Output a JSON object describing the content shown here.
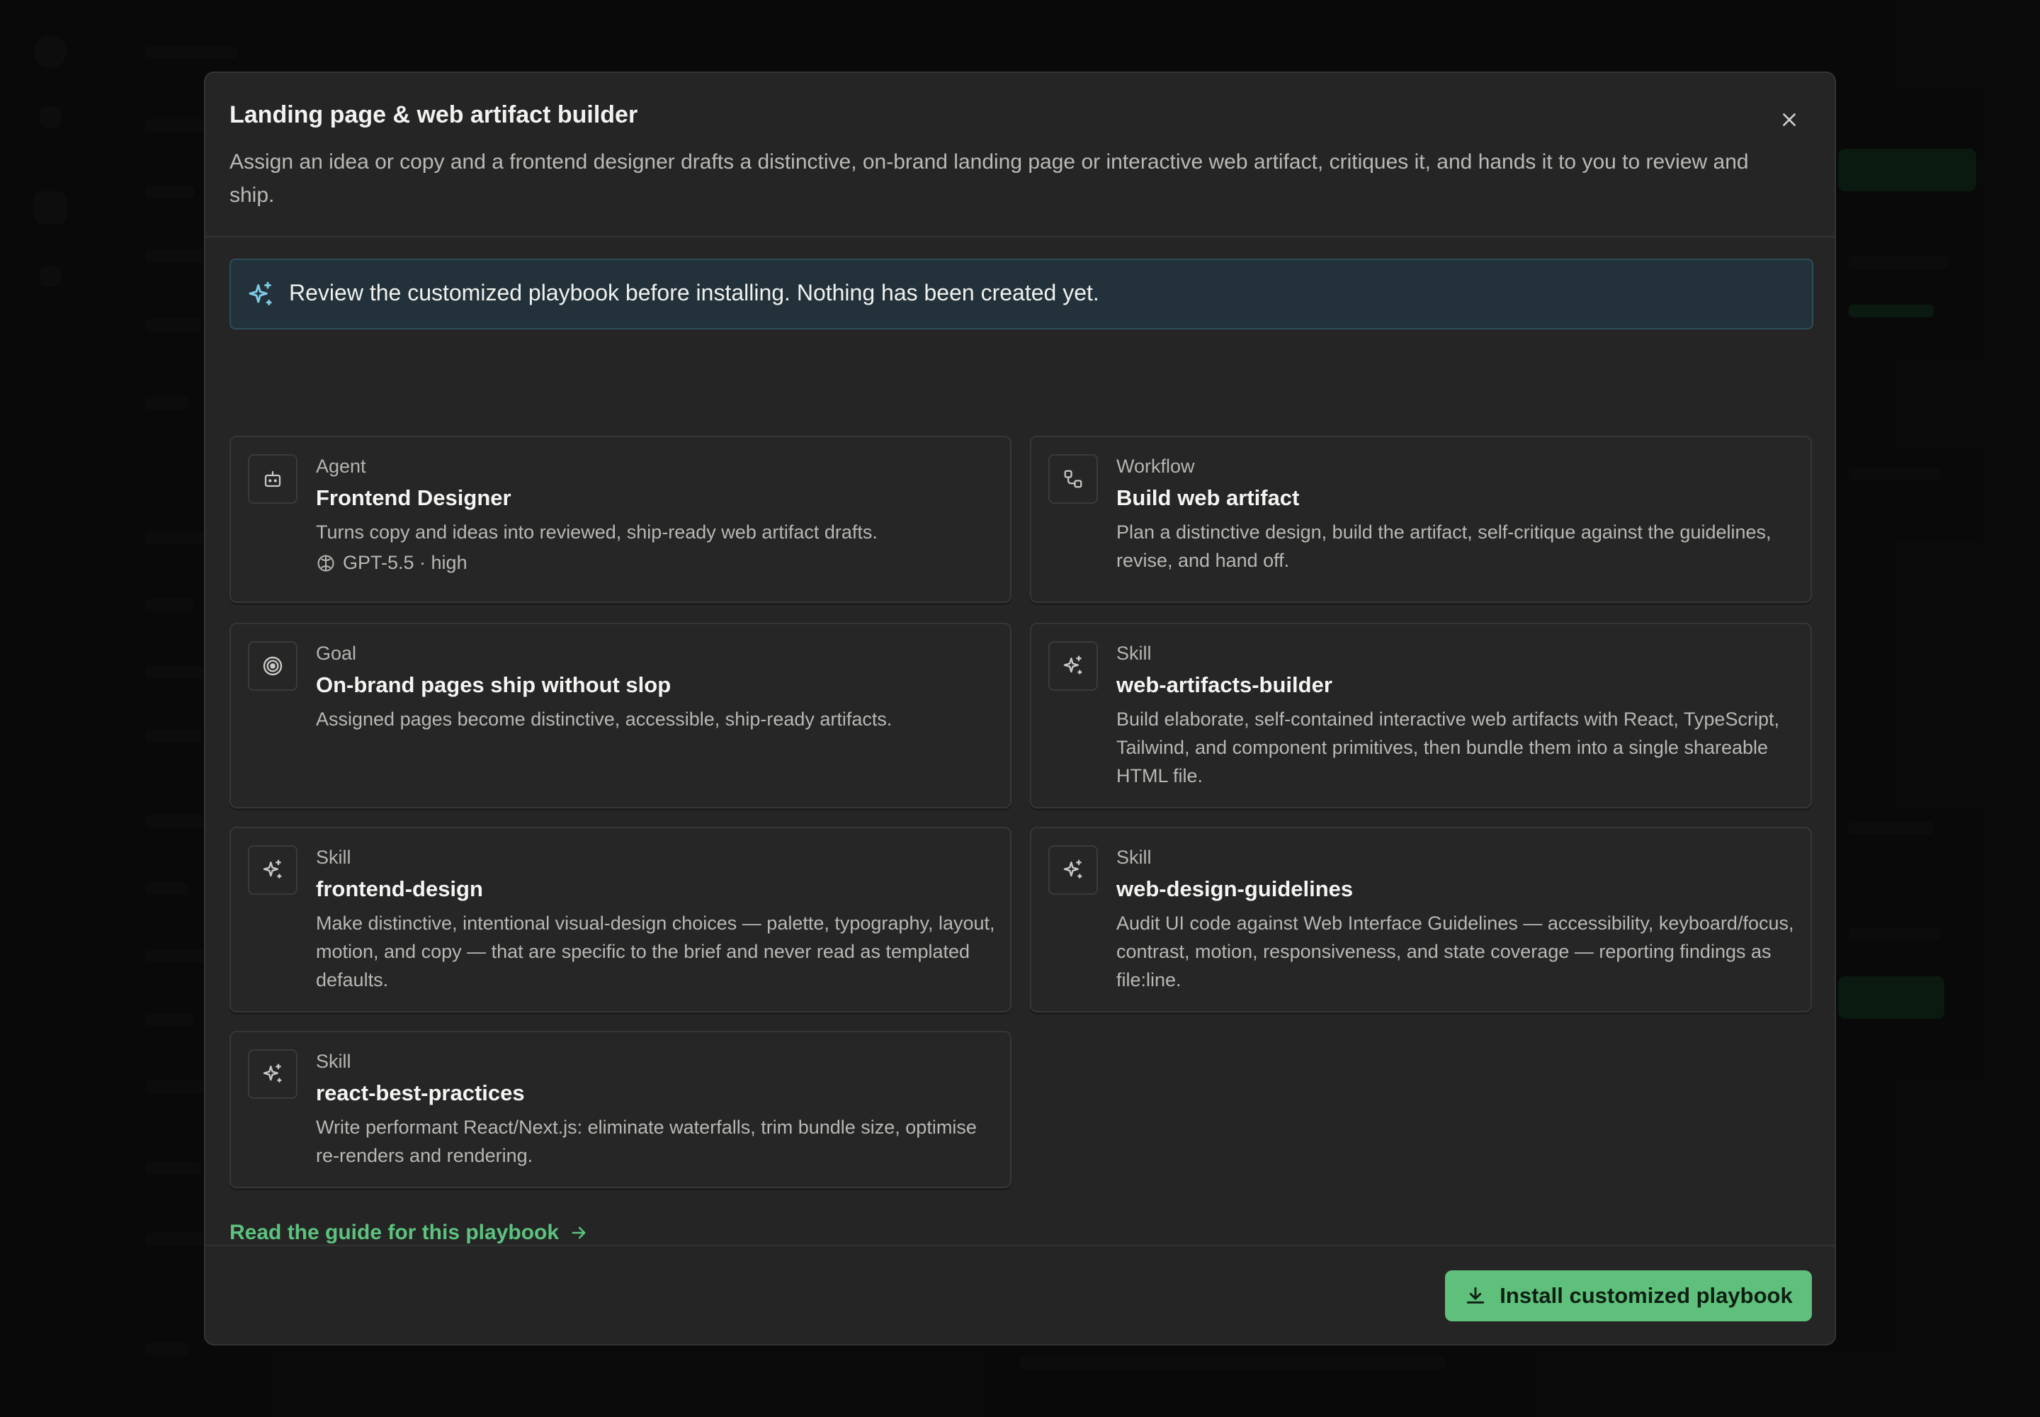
{
  "modal": {
    "title": "Landing page & web artifact builder",
    "description": "Assign an idea or copy and a frontend designer drafts a distinctive, on-brand landing page or interactive web artifact, critiques it, and hands it to you to review and ship.",
    "close_icon": "close-icon"
  },
  "notice": {
    "icon": "sparkles-icon",
    "text": "Review the customized playbook before installing. Nothing has been created yet."
  },
  "cards": [
    {
      "type": "Agent",
      "title": "Frontend Designer",
      "description": "Turns copy and ideas into reviewed, ship-ready web artifact drafts.",
      "model": "GPT-5.5 · high",
      "icon": "bot-icon"
    },
    {
      "type": "Workflow",
      "title": "Build web artifact",
      "description": "Plan a distinctive design, build the artifact, self-critique against the guidelines, revise, and hand off.",
      "icon": "workflow-icon"
    },
    {
      "type": "Goal",
      "title": "On-brand pages ship without slop",
      "description": "Assigned pages become distinctive, accessible, ship-ready artifacts.",
      "icon": "target-icon"
    },
    {
      "type": "Skill",
      "title": "web-artifacts-builder",
      "description": "Build elaborate, self-contained interactive web artifacts with React, TypeScript, Tailwind, and component primitives, then bundle them into a single shareable HTML file.",
      "icon": "sparkles-icon"
    },
    {
      "type": "Skill",
      "title": "frontend-design",
      "description": "Make distinctive, intentional visual-design choices — palette, typography, layout, motion, and copy — that are specific to the brief and never read as templated defaults.",
      "icon": "sparkles-icon"
    },
    {
      "type": "Skill",
      "title": "web-design-guidelines",
      "description": "Audit UI code against Web Interface Guidelines — accessibility, keyboard/focus, contrast, motion, responsiveness, and state coverage — reporting findings as file:line.",
      "icon": "sparkles-icon"
    },
    {
      "type": "Skill",
      "title": "react-best-practices",
      "description": "Write performant React/Next.js: eliminate waterfalls, trim bundle size, optimise re-renders and rendering.",
      "icon": "sparkles-icon"
    }
  ],
  "guide_link": "Read the guide for this playbook",
  "footer": {
    "install_label": "Install customized playbook"
  },
  "colors": {
    "accent": "#5ec07b",
    "notice_bg": "#23323a",
    "modal_bg": "#252525"
  }
}
